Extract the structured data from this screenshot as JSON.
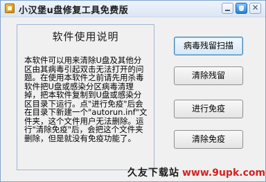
{
  "window": {
    "title": "小汉堡u盘修复工具免费版",
    "close_glyph": "✕"
  },
  "panel": {
    "heading": "软件使用说明",
    "body": "本软件可以用来清除U盘及其他分区由其病毒引起双击无法打开的问题。在使用本软件之前请先用杀毒软件把U盘或感染分区病毒清理掉，把本软件复制到U盘或感染分区目录下运行。点\"进行免疫\"后会在目录下新建一个\"autorun.inf\"文件夹，这个文件用户无法删除。运行\"清除免疫\"后，会把这个文件夹删除，但是就没有免疫功能了。"
  },
  "buttons": {
    "scan": "病毒残留扫描",
    "clean": "清除残留",
    "immune": "进行免疫",
    "remove_immune": "清除免疫"
  },
  "watermark": {
    "name": "久友下载站",
    "url": "www.9upk.com"
  },
  "colors": {
    "window_border": "#7da2ce",
    "primary_border": "#3c7fb1",
    "watermark_url": "#d62020"
  }
}
